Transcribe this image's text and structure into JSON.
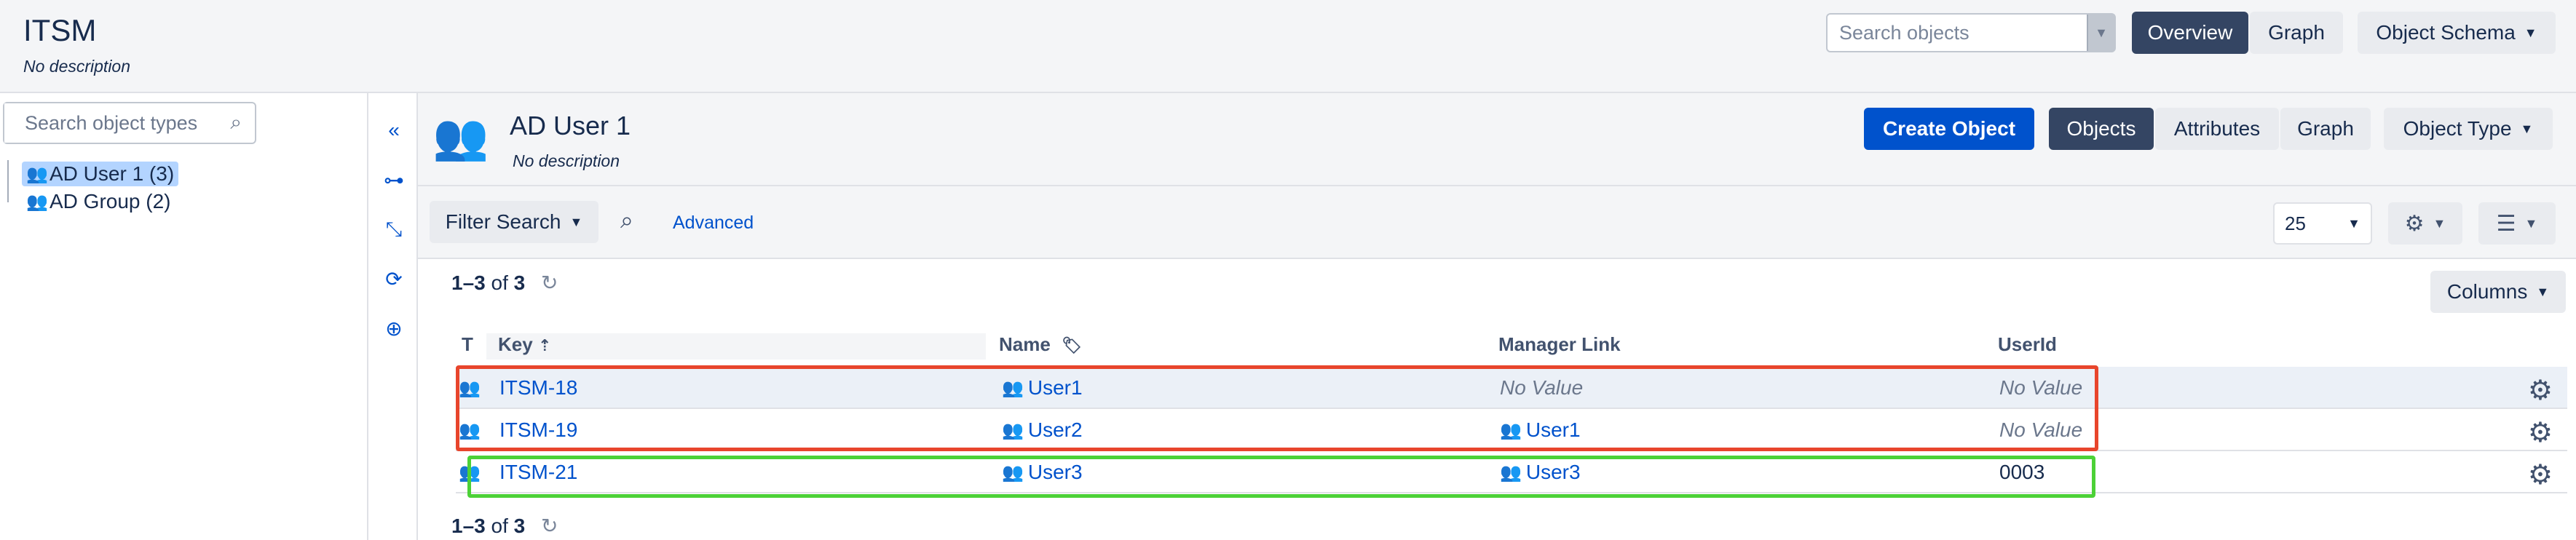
{
  "app": {
    "title": "ITSM",
    "description": "No description"
  },
  "header": {
    "search_placeholder": "Search objects",
    "overview_label": "Overview",
    "graph_label": "Graph",
    "schema_label": "Object Schema"
  },
  "tree": {
    "search_placeholder": "Search object types",
    "items": [
      {
        "label": "AD User 1 (3)",
        "icon": "user-pair-icon",
        "selected": true
      },
      {
        "label": "AD Group (2)",
        "icon": "group-icon",
        "selected": false
      }
    ]
  },
  "object_type": {
    "title": "AD User 1",
    "description": "No description",
    "create_label": "Create Object",
    "tabs": [
      "Objects",
      "Attributes",
      "Graph"
    ],
    "type_menu_label": "Object Type"
  },
  "filter": {
    "filter_label": "Filter Search",
    "advanced_label": "Advanced",
    "page_size": "25",
    "columns_label": "Columns"
  },
  "results": {
    "range": "1–3",
    "of": "of",
    "total": "3"
  },
  "table": {
    "columns": [
      "T",
      "Key",
      "Name",
      "Manager Link",
      "UserId"
    ],
    "rows": [
      {
        "key": "ITSM-18",
        "name": "User1",
        "manager": "No Value",
        "manager_is_link": false,
        "userid": "No Value",
        "userid_is_value": false
      },
      {
        "key": "ITSM-19",
        "name": "User2",
        "manager": "User1",
        "manager_is_link": true,
        "userid": "No Value",
        "userid_is_value": false
      },
      {
        "key": "ITSM-21",
        "name": "User3",
        "manager": "User3",
        "manager_is_link": true,
        "userid": "0003",
        "userid_is_value": true
      }
    ]
  },
  "colors": {
    "primary": "#0052cc",
    "dark_button": "#344563",
    "highlight_red": "#e8452c",
    "highlight_green": "#4cd137"
  }
}
